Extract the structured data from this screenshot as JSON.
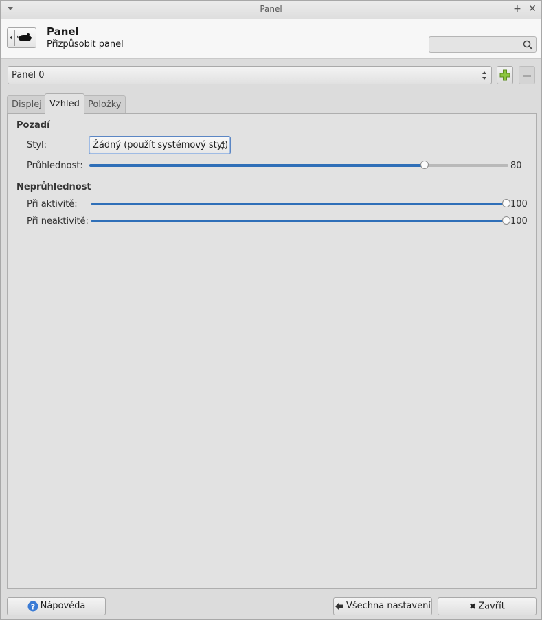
{
  "window": {
    "title": "Panel"
  },
  "header": {
    "title": "Panel",
    "subtitle": "Přizpůsobit panel",
    "search": {
      "placeholder": ""
    }
  },
  "panel_select": {
    "value": "Panel 0"
  },
  "tabs": [
    {
      "label": "Displej",
      "active": false
    },
    {
      "label": "Vzhled",
      "active": true
    },
    {
      "label": "Položky",
      "active": false
    }
  ],
  "background": {
    "heading": "Pozadí",
    "style_label": "Styl:",
    "style_value": "Žádný (použít systémový styl)",
    "transparency_label": "Průhlednost:",
    "transparency_value": "80",
    "transparency_fraction": 0.8
  },
  "opacity": {
    "heading": "Neprůhlednost",
    "active_label": "Při aktivitě:",
    "active_value": "100",
    "inactive_label": "Při neaktivitě:",
    "inactive_value": "100"
  },
  "footer": {
    "help_label": "Nápověda",
    "all_settings_label": "Všechna nastavení",
    "close_label": "Zavřít"
  },
  "colors": {
    "accent": "#2f6fb8",
    "help_icon": "#3a7bd5",
    "add_icon": "#8cc63f"
  }
}
